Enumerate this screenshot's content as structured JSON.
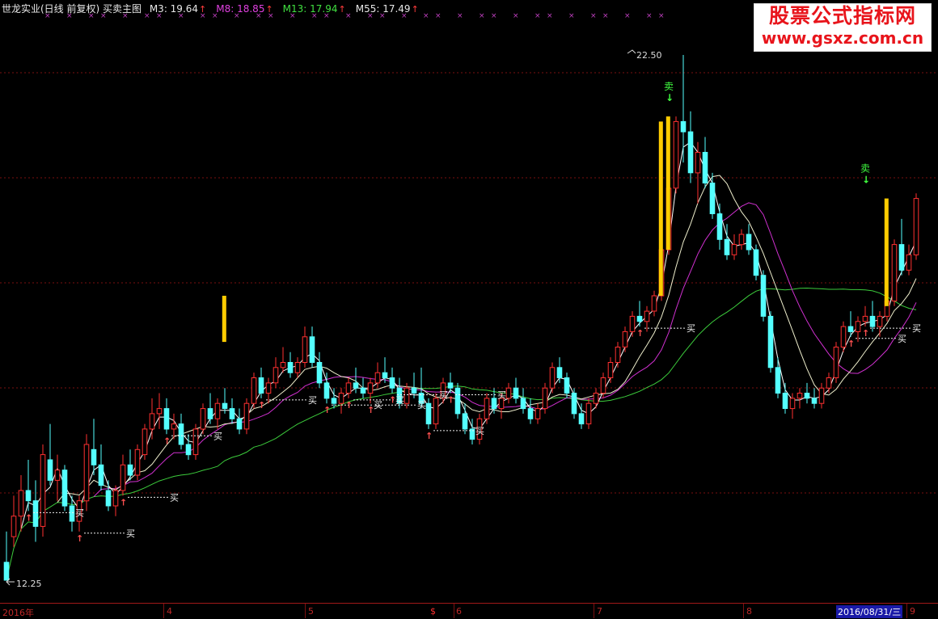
{
  "header": {
    "title": "世龙实业(日线 前复权) 买卖主图",
    "ma_items": [
      {
        "label": "M3: 19.64",
        "color": "#e8e8e8"
      },
      {
        "label": "M8: 18.85",
        "color": "#e040e0"
      },
      {
        "label": "M13: 17.94",
        "color": "#40e040"
      },
      {
        "label": "M55: 17.49",
        "color": "#e8e8e8"
      }
    ],
    "arrow": "↑"
  },
  "logo": {
    "line1": "股票公式指标网",
    "line2": "www.gsxz.com.cn"
  },
  "price_labels": {
    "high": "22.50",
    "low": "12.25"
  },
  "signals": {
    "buy": "买",
    "sell": "卖"
  },
  "time_axis": {
    "labels": [
      "2016年",
      "4",
      "5",
      "6",
      "7",
      "8",
      "9"
    ],
    "marker": "$",
    "cursor_date": "2016/08/31/三"
  },
  "colors": {
    "up": "#ff3030",
    "down": "#54ffff",
    "bg": "#000000",
    "grid": "#7a1010",
    "highlight": "#ffcc00"
  },
  "chart_data": {
    "type": "candlestick",
    "ylim": [
      12.25,
      22.5
    ],
    "candles": [
      [
        12.6,
        13.2,
        12.3,
        12.25
      ],
      [
        13.1,
        13.9,
        12.9,
        13.5
      ],
      [
        13.5,
        14.3,
        13.2,
        14.0
      ],
      [
        14.0,
        14.6,
        13.6,
        13.8
      ],
      [
        13.8,
        14.2,
        13.0,
        13.3
      ],
      [
        13.3,
        14.9,
        13.1,
        14.7
      ],
      [
        14.6,
        15.3,
        14.1,
        14.2
      ],
      [
        14.2,
        14.7,
        13.8,
        14.4
      ],
      [
        14.4,
        14.5,
        13.6,
        13.7
      ],
      [
        13.7,
        13.9,
        13.2,
        13.4
      ],
      [
        13.4,
        13.9,
        13.2,
        13.8
      ],
      [
        13.8,
        15.1,
        13.6,
        14.9
      ],
      [
        14.8,
        15.4,
        14.3,
        14.5
      ],
      [
        14.5,
        14.9,
        14.0,
        14.1
      ],
      [
        14.0,
        14.2,
        13.6,
        13.7
      ],
      [
        13.7,
        14.1,
        13.5,
        14.0
      ],
      [
        14.0,
        14.7,
        13.9,
        14.5
      ],
      [
        14.5,
        14.8,
        14.2,
        14.3
      ],
      [
        14.3,
        14.9,
        14.2,
        14.8
      ],
      [
        14.7,
        15.3,
        14.6,
        15.2
      ],
      [
        15.2,
        15.8,
        15.0,
        15.5
      ],
      [
        15.5,
        15.9,
        15.2,
        15.6
      ],
      [
        15.6,
        15.8,
        15.1,
        15.2
      ],
      [
        15.2,
        15.5,
        15.0,
        15.3
      ],
      [
        15.3,
        15.5,
        14.8,
        14.9
      ],
      [
        14.9,
        15.1,
        14.6,
        14.7
      ],
      [
        14.7,
        15.3,
        14.6,
        15.2
      ],
      [
        15.2,
        15.7,
        15.1,
        15.6
      ],
      [
        15.6,
        15.9,
        15.3,
        15.4
      ],
      [
        15.4,
        15.8,
        15.2,
        15.7
      ],
      [
        15.7,
        16.0,
        15.5,
        15.6
      ],
      [
        15.6,
        15.8,
        15.3,
        15.4
      ],
      [
        15.4,
        15.6,
        15.1,
        15.2
      ],
      [
        15.2,
        15.8,
        15.1,
        15.7
      ],
      [
        15.7,
        16.3,
        15.6,
        16.2
      ],
      [
        16.2,
        16.4,
        15.8,
        15.9
      ],
      [
        15.9,
        16.2,
        15.7,
        16.1
      ],
      [
        16.1,
        16.6,
        16.0,
        16.4
      ],
      [
        16.4,
        16.8,
        16.3,
        16.5
      ],
      [
        16.5,
        16.7,
        16.2,
        16.3
      ],
      [
        16.3,
        16.6,
        16.2,
        16.5
      ],
      [
        16.5,
        17.2,
        16.4,
        17.0
      ],
      [
        17.0,
        17.2,
        16.4,
        16.5
      ],
      [
        16.5,
        16.7,
        16.0,
        16.1
      ],
      [
        16.1,
        16.3,
        15.7,
        15.8
      ],
      [
        15.8,
        16.0,
        15.6,
        15.7
      ],
      [
        15.7,
        16.0,
        15.5,
        15.9
      ],
      [
        15.9,
        16.2,
        15.8,
        16.1
      ],
      [
        16.1,
        16.4,
        15.9,
        16.0
      ],
      [
        16.0,
        16.2,
        15.8,
        15.9
      ],
      [
        15.9,
        16.2,
        15.7,
        16.1
      ],
      [
        16.1,
        16.5,
        16.0,
        16.3
      ],
      [
        16.3,
        16.6,
        16.1,
        16.2
      ],
      [
        16.2,
        16.4,
        15.9,
        16.0
      ],
      [
        16.0,
        16.2,
        15.6,
        15.7
      ],
      [
        15.7,
        16.1,
        15.6,
        16.0
      ],
      [
        16.0,
        16.3,
        15.8,
        15.9
      ],
      [
        15.9,
        16.4,
        15.6,
        15.7
      ],
      [
        15.7,
        15.8,
        15.2,
        15.3
      ],
      [
        15.3,
        15.9,
        15.2,
        15.8
      ],
      [
        15.8,
        16.2,
        15.7,
        16.1
      ],
      [
        16.1,
        16.3,
        15.9,
        16.0
      ],
      [
        16.0,
        16.1,
        15.4,
        15.5
      ],
      [
        15.5,
        15.7,
        15.1,
        15.2
      ],
      [
        15.2,
        15.4,
        14.9,
        15.0
      ],
      [
        15.0,
        15.5,
        14.9,
        15.4
      ],
      [
        15.4,
        15.9,
        15.3,
        15.8
      ],
      [
        15.8,
        16.0,
        15.5,
        15.6
      ],
      [
        15.6,
        15.9,
        15.4,
        15.8
      ],
      [
        15.8,
        16.1,
        15.7,
        16.0
      ],
      [
        16.0,
        16.2,
        15.7,
        15.8
      ],
      [
        15.8,
        16.0,
        15.5,
        15.6
      ],
      [
        15.6,
        15.8,
        15.3,
        15.4
      ],
      [
        15.4,
        15.7,
        15.3,
        15.6
      ],
      [
        15.6,
        16.1,
        15.5,
        16.0
      ],
      [
        16.0,
        16.5,
        15.9,
        16.4
      ],
      [
        16.4,
        16.6,
        16.1,
        16.2
      ],
      [
        16.2,
        16.3,
        15.8,
        15.9
      ],
      [
        15.9,
        16.0,
        15.4,
        15.5
      ],
      [
        15.5,
        15.7,
        15.2,
        15.3
      ],
      [
        15.3,
        15.8,
        15.2,
        15.7
      ],
      [
        15.7,
        16.0,
        15.6,
        15.9
      ],
      [
        15.9,
        16.3,
        15.8,
        16.2
      ],
      [
        16.2,
        16.6,
        16.1,
        16.5
      ],
      [
        16.5,
        16.9,
        16.4,
        16.8
      ],
      [
        16.8,
        17.2,
        16.7,
        17.1
      ],
      [
        17.1,
        17.5,
        17.0,
        17.4
      ],
      [
        17.4,
        17.7,
        17.2,
        17.3
      ],
      [
        17.3,
        17.6,
        17.1,
        17.5
      ],
      [
        17.5,
        17.9,
        17.4,
        17.8
      ],
      [
        17.8,
        18.8,
        17.7,
        18.7
      ],
      [
        18.7,
        20.0,
        18.6,
        19.9
      ],
      [
        19.9,
        21.3,
        19.8,
        21.2
      ],
      [
        21.2,
        22.5,
        20.4,
        21.0
      ],
      [
        21.0,
        21.4,
        20.0,
        20.2
      ],
      [
        20.2,
        20.8,
        19.6,
        20.6
      ],
      [
        20.6,
        20.9,
        19.9,
        20.0
      ],
      [
        20.0,
        20.2,
        19.3,
        19.4
      ],
      [
        19.4,
        19.6,
        18.7,
        18.9
      ],
      [
        18.9,
        19.2,
        18.5,
        18.6
      ],
      [
        18.6,
        19.0,
        18.5,
        18.8
      ],
      [
        18.8,
        19.1,
        18.7,
        19.0
      ],
      [
        19.0,
        19.2,
        18.6,
        18.7
      ],
      [
        18.7,
        18.8,
        18.1,
        18.2
      ],
      [
        18.2,
        18.3,
        17.3,
        17.4
      ],
      [
        17.4,
        17.5,
        16.3,
        16.4
      ],
      [
        16.4,
        16.6,
        15.8,
        15.9
      ],
      [
        15.9,
        16.1,
        15.5,
        15.6
      ],
      [
        15.6,
        15.9,
        15.4,
        15.8
      ],
      [
        15.8,
        16.0,
        15.6,
        15.9
      ],
      [
        15.9,
        16.1,
        15.7,
        15.8
      ],
      [
        15.8,
        16.0,
        15.6,
        15.7
      ],
      [
        15.7,
        16.1,
        15.6,
        16.0
      ],
      [
        16.0,
        16.3,
        15.9,
        16.2
      ],
      [
        16.2,
        16.9,
        16.1,
        16.8
      ],
      [
        16.8,
        17.3,
        16.7,
        17.2
      ],
      [
        17.2,
        17.5,
        17.0,
        17.1
      ],
      [
        17.1,
        17.4,
        16.9,
        17.3
      ],
      [
        17.3,
        17.6,
        17.2,
        17.4
      ],
      [
        17.4,
        17.7,
        17.1,
        17.2
      ],
      [
        17.2,
        17.5,
        17.0,
        17.4
      ],
      [
        17.4,
        17.8,
        17.3,
        17.7
      ],
      [
        17.7,
        18.9,
        17.6,
        18.8
      ],
      [
        18.8,
        19.3,
        18.2,
        18.3
      ],
      [
        18.3,
        18.8,
        18.2,
        18.6
      ],
      [
        18.6,
        19.8,
        18.5,
        19.7
      ]
    ],
    "ma_lines": [
      "M3",
      "M8",
      "M13",
      "M55"
    ],
    "buy_signal_count": 14,
    "sell_signal_count": 2
  }
}
